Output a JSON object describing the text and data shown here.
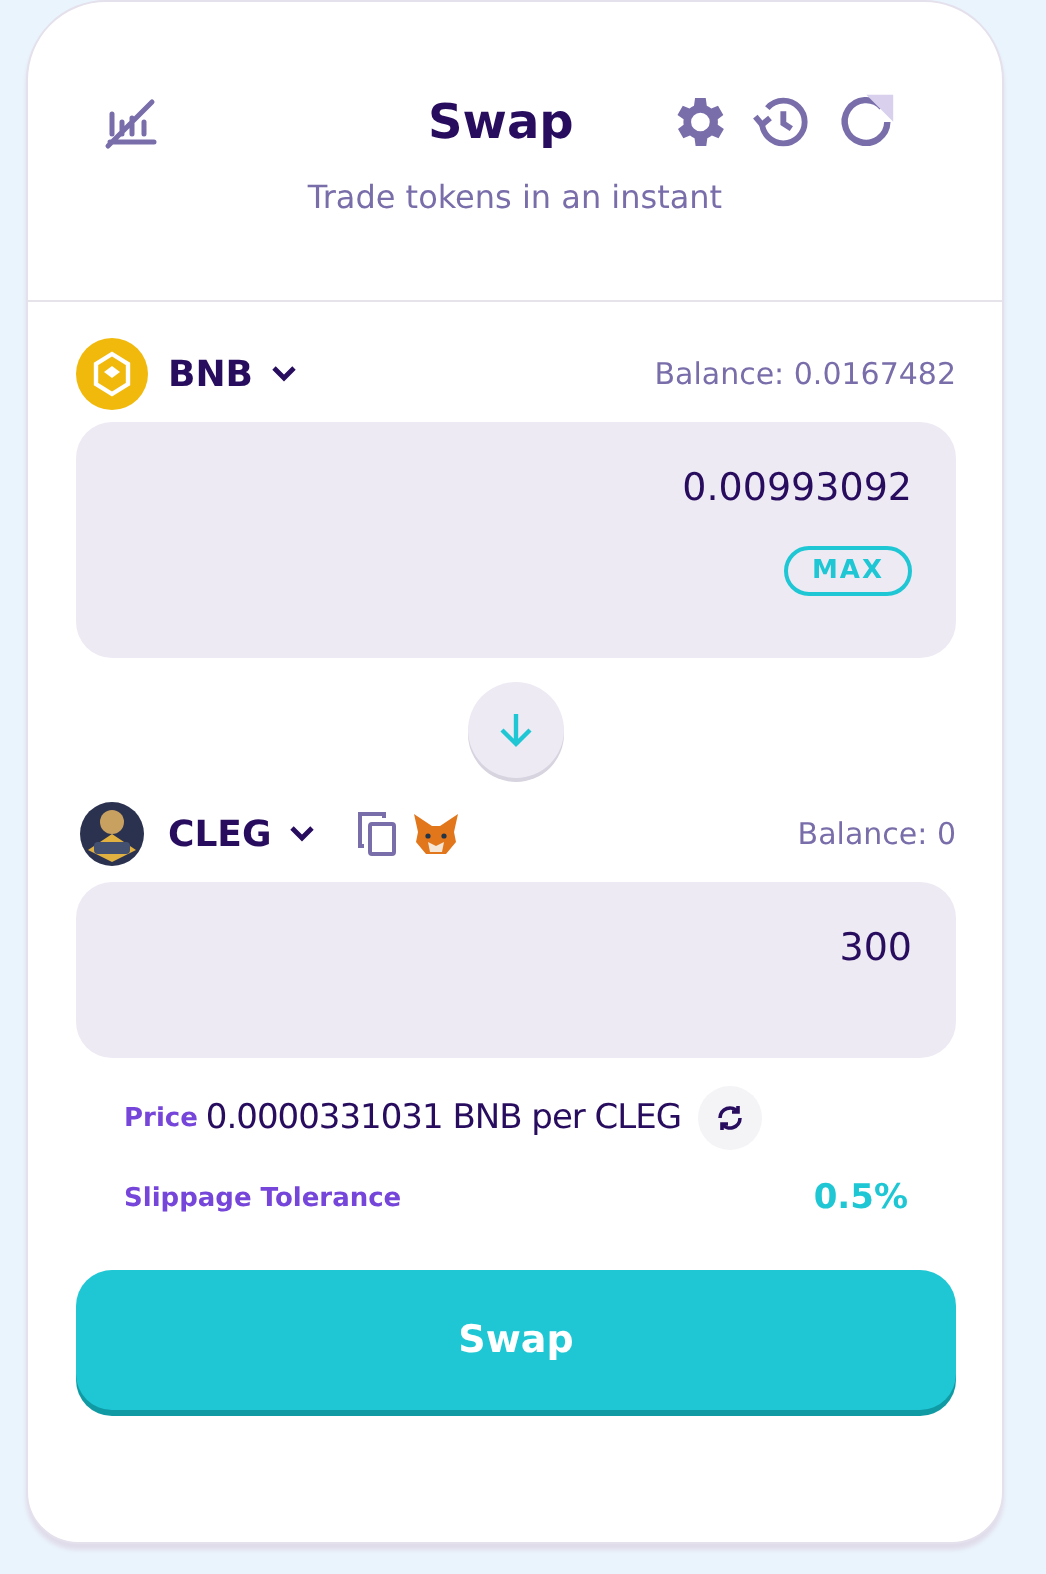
{
  "header": {
    "title": "Swap",
    "subtitle": "Trade tokens in an instant"
  },
  "from": {
    "symbol": "BNB",
    "balance": "Balance: 0.0167482",
    "amount": "0.00993092",
    "max": "MAX"
  },
  "to": {
    "symbol": "CLEG",
    "balance": "Balance: 0",
    "amount": "300"
  },
  "price": {
    "label": "Price",
    "value": "0.0000331031 BNB per CLEG"
  },
  "slippage": {
    "label": "Slippage Tolerance",
    "value": "0.5%"
  },
  "swap_button": "Swap"
}
